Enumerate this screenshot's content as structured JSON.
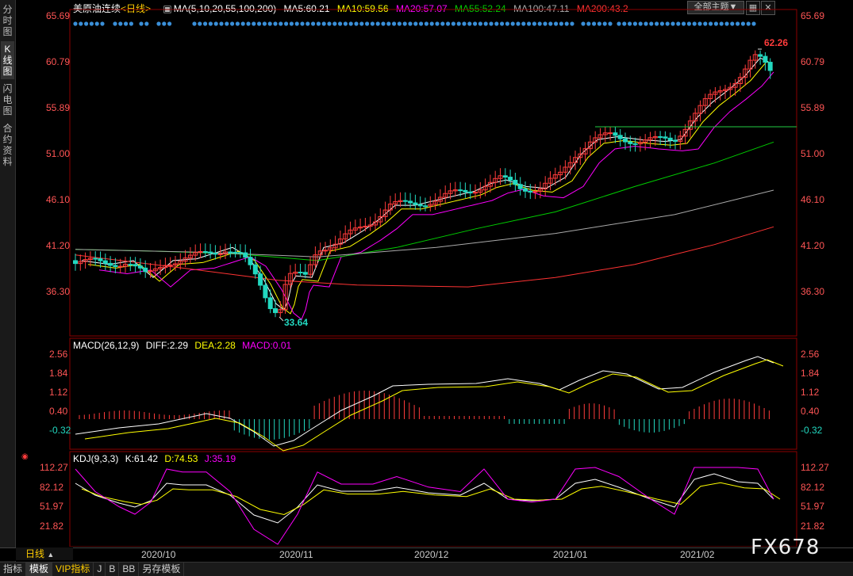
{
  "left_tabs": [
    "分时图",
    "K线图",
    "闪电图",
    "合约资料"
  ],
  "header": {
    "symbol": "美原油连续",
    "period_tag": "<日线>",
    "ma_label": "MA(5,10,20,55,100,200)",
    "ma5": "MA5:60.21",
    "ma10": "MA10:59.56",
    "ma20": "MA20:57.07",
    "ma55": "MA55:52.24",
    "ma100": "MA100:47.11",
    "ma200": "MA200:43.2",
    "theme_button": "全部主题▼",
    "grid_icon": "▦",
    "close_icon": "✕"
  },
  "price_axis": [
    "65.69",
    "60.79",
    "55.89",
    "51.00",
    "46.10",
    "41.20",
    "36.30"
  ],
  "annotations": {
    "high": "62.26",
    "low": "33.64"
  },
  "macd": {
    "title": "MACD(26,12,9)",
    "diff": "DIFF:2.29",
    "dea": "DEA:2.28",
    "macd": "MACD:0.01",
    "axis": [
      "2.56",
      "1.84",
      "1.12",
      "0.40",
      "-0.32"
    ]
  },
  "kdj": {
    "title": "KDJ(9,3,3)",
    "k": "K:61.42",
    "d": "D:74.53",
    "j": "J:35.19",
    "axis": [
      "112.27",
      "82.12",
      "51.97",
      "21.82"
    ]
  },
  "dates": [
    "2020/10",
    "2020/11",
    "2020/12",
    "2021/01",
    "2021/02"
  ],
  "period_button": "日线",
  "bottom_tabs": [
    "指标",
    "模板",
    "VIP指标",
    "J",
    "B",
    "BB",
    "另存模板"
  ],
  "watermark": "FX678",
  "colors": {
    "up": "#ff3b3b",
    "down": "#22d8c0",
    "ma5": "#ffffff",
    "ma10": "#ffff00",
    "ma20": "#ff00ff",
    "ma55": "#00cc00",
    "ma100": "#aaaaaa",
    "ma200": "#ff3333"
  },
  "chart_data": {
    "type": "candlestick",
    "price_range": [
      33.64,
      62.26
    ],
    "high": 62.26,
    "low": 33.64,
    "last_values": {
      "ma5": 60.21,
      "ma10": 59.56,
      "ma20": 57.07,
      "ma55": 52.24,
      "ma100": 47.11,
      "ma200": 43.2
    },
    "macd_last": {
      "diff": 2.29,
      "dea": 2.28,
      "macd": 0.01
    },
    "kdj_last": {
      "k": 61.42,
      "d": 74.53,
      "j": 35.19
    }
  }
}
